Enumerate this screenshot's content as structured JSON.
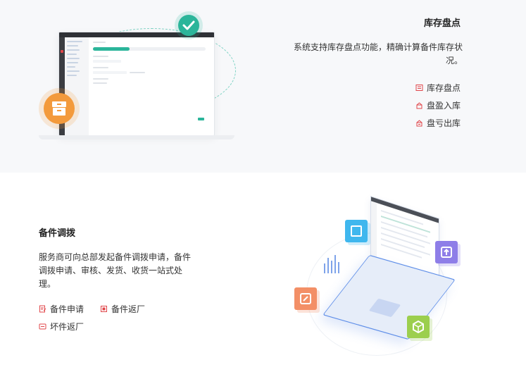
{
  "stock_check": {
    "title": "库存盘点",
    "description": "系统支持库存盘点功能，精确计算备件库存状况。",
    "features": [
      {
        "label": "库存盘点",
        "icon": "inventory-icon"
      },
      {
        "label": "盘盈入库",
        "icon": "surplus-inbound-icon"
      },
      {
        "label": "盘亏出库",
        "icon": "loss-outbound-icon"
      }
    ]
  },
  "parts_transfer": {
    "title": "备件调拨",
    "description": "服务商可向总部发起备件调拨申请，备件调拨申请、审核、发货、收货一站式处理。",
    "features": [
      {
        "label": "备件申请",
        "icon": "parts-request-icon"
      },
      {
        "label": "备件返厂",
        "icon": "parts-return-icon"
      },
      {
        "label": "坏件返厂",
        "icon": "defective-return-icon"
      }
    ]
  },
  "colors": {
    "accent_green": "#2bb59a",
    "accent_orange": "#f39a3c",
    "icon_red": "#e0464a",
    "section_bg": "#f7f8fa"
  }
}
